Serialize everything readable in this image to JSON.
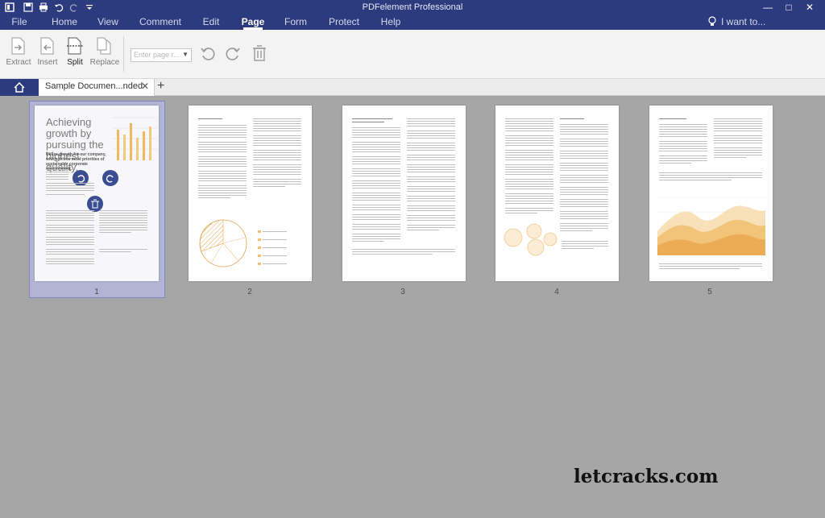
{
  "window": {
    "title": "PDFelement   Professional",
    "controls": [
      "minimize",
      "maximize",
      "close"
    ]
  },
  "quick_access": [
    "app-icon",
    "save-icon",
    "print-icon",
    "undo-icon",
    "redo-icon",
    "customize-icon"
  ],
  "menu": {
    "items": [
      "File",
      "Home",
      "View",
      "Comment",
      "Edit",
      "Page",
      "Form",
      "Protect",
      "Help"
    ],
    "active": "Page"
  },
  "search": {
    "placeholder": "I want to..."
  },
  "ribbon": {
    "tools": [
      {
        "label": "Extract",
        "icon": "extract-icon"
      },
      {
        "label": "Insert",
        "icon": "insert-icon"
      },
      {
        "label": "Split",
        "icon": "split-icon"
      },
      {
        "label": "Replace",
        "icon": "replace-icon"
      }
    ],
    "page_select_placeholder": "Enter page r...",
    "rotate_icons": [
      "rotate-left-icon",
      "rotate-right-icon",
      "delete-icon"
    ]
  },
  "tabs": {
    "home_icon": "home-icon",
    "document_tab": "Sample Documen...nded",
    "add_icon": "+"
  },
  "pages": {
    "numbers": [
      "1",
      "2",
      "3",
      "4",
      "5"
    ],
    "selected": "1",
    "page1_heading": "Achieving growth by pursuing the highest quality.",
    "page1_subheading": "Utilize growth for our company, which drives most priorities of sustainable corporate development."
  },
  "colors": {
    "title_bar": "#2c3a7e",
    "selection": "#b3b3d6",
    "chart_orange": "#f0b860"
  },
  "watermark": "letcracks.com"
}
